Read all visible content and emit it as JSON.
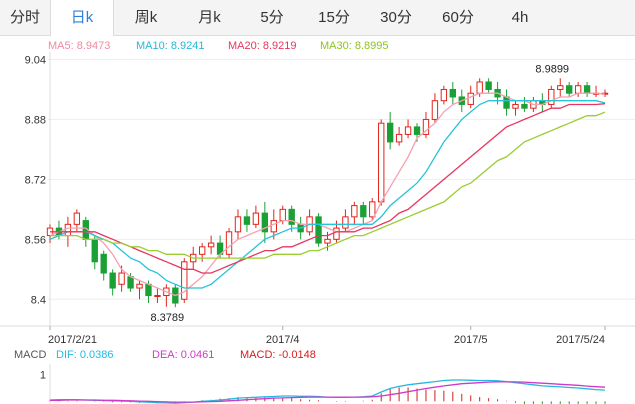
{
  "tabs": [
    "分时",
    "日k",
    "周k",
    "月k",
    "5分",
    "15分",
    "30分",
    "60分",
    "4h"
  ],
  "active_tab": 1,
  "colors": {
    "up": "#e1251b",
    "down": "#1aa035",
    "ma5": "#f5a0b0",
    "ma10": "#27c3d6",
    "ma20": "#e8365f",
    "ma30": "#9acd32",
    "dif": "#27b8e0",
    "dea": "#cc3cc8",
    "macd": "#d81b1b"
  },
  "legend": [
    {
      "label": "MA5: 8.9473",
      "color": "#f08aa2"
    },
    {
      "label": "MA10: 8.9241",
      "color": "#27b8d6"
    },
    {
      "label": "MA20: 8.9219",
      "color": "#e8365f"
    },
    {
      "label": "MA30: 8.8995",
      "color": "#8fc31f"
    }
  ],
  "macd_legend": [
    {
      "label": "MACD",
      "color": "#555555"
    },
    {
      "label": "DIF: 0.0386",
      "color": "#27b8e0"
    },
    {
      "label": "DEA: 0.0461",
      "color": "#cc3cc8"
    },
    {
      "label": "MACD: -0.0148",
      "color": "#d81b1b"
    }
  ],
  "chart_data": {
    "type": "candlestick",
    "ylim": [
      8.35,
      9.06
    ],
    "y_ticks": [
      9.04,
      8.88,
      8.72,
      8.56,
      8.4
    ],
    "y_tick_labels": [
      "9.04",
      "8.88",
      "8.72",
      "8.56",
      "8.4"
    ],
    "x_tick_labels": [
      {
        "label": "2017/2/21",
        "index": 0
      },
      {
        "label": "2017/4",
        "index": 26
      },
      {
        "label": "2017/5",
        "index": 47
      },
      {
        "label": "2017/5/24",
        "index": 62
      }
    ],
    "annotations": [
      {
        "label": "8.9899",
        "index": 57,
        "value": 8.9899
      },
      {
        "label": "8.3789",
        "index": 14,
        "value": 8.3789
      }
    ],
    "candles": [
      [
        8.57,
        8.59,
        8.55,
        8.6
      ],
      [
        8.59,
        8.57,
        8.56,
        8.61
      ],
      [
        8.57,
        8.6,
        8.54,
        8.62
      ],
      [
        8.6,
        8.63,
        8.58,
        8.64
      ],
      [
        8.61,
        8.56,
        8.54,
        8.62
      ],
      [
        8.56,
        8.5,
        8.48,
        8.57
      ],
      [
        8.52,
        8.47,
        8.45,
        8.53
      ],
      [
        8.47,
        8.43,
        8.41,
        8.48
      ],
      [
        8.44,
        8.47,
        8.42,
        8.49
      ],
      [
        8.46,
        8.43,
        8.42,
        8.47
      ],
      [
        8.43,
        8.44,
        8.4,
        8.45
      ],
      [
        8.44,
        8.41,
        8.39,
        8.45
      ],
      [
        8.41,
        8.41,
        8.39,
        8.43
      ],
      [
        8.41,
        8.43,
        8.38,
        8.44
      ],
      [
        8.43,
        8.39,
        8.3789,
        8.44
      ],
      [
        8.4,
        8.5,
        8.39,
        8.51
      ],
      [
        8.5,
        8.52,
        8.48,
        8.54
      ],
      [
        8.52,
        8.54,
        8.5,
        8.55
      ],
      [
        8.54,
        8.55,
        8.52,
        8.57
      ],
      [
        8.55,
        8.52,
        8.51,
        8.57
      ],
      [
        8.52,
        8.58,
        8.51,
        8.59
      ],
      [
        8.58,
        8.62,
        8.56,
        8.64
      ],
      [
        8.62,
        8.6,
        8.58,
        8.64
      ],
      [
        8.6,
        8.63,
        8.59,
        8.65
      ],
      [
        8.63,
        8.58,
        8.55,
        8.66
      ],
      [
        8.58,
        8.61,
        8.56,
        8.64
      ],
      [
        8.61,
        8.64,
        8.6,
        8.65
      ],
      [
        8.64,
        8.6,
        8.58,
        8.65
      ],
      [
        8.6,
        8.58,
        8.56,
        8.62
      ],
      [
        8.58,
        8.62,
        8.57,
        8.64
      ],
      [
        8.62,
        8.55,
        8.54,
        8.63
      ],
      [
        8.55,
        8.56,
        8.53,
        8.58
      ],
      [
        8.56,
        8.59,
        8.55,
        8.61
      ],
      [
        8.59,
        8.62,
        8.58,
        8.64
      ],
      [
        8.62,
        8.65,
        8.6,
        8.66
      ],
      [
        8.65,
        8.62,
        8.6,
        8.66
      ],
      [
        8.62,
        8.66,
        8.61,
        8.67
      ],
      [
        8.66,
        8.87,
        8.65,
        8.88
      ],
      [
        8.87,
        8.82,
        8.8,
        8.9
      ],
      [
        8.82,
        8.84,
        8.81,
        8.86
      ],
      [
        8.84,
        8.86,
        8.83,
        8.88
      ],
      [
        8.86,
        8.84,
        8.82,
        8.87
      ],
      [
        8.84,
        8.88,
        8.83,
        8.9
      ],
      [
        8.88,
        8.93,
        8.87,
        8.95
      ],
      [
        8.93,
        8.96,
        8.92,
        8.97
      ],
      [
        8.96,
        8.94,
        8.92,
        8.98
      ],
      [
        8.94,
        8.92,
        8.9,
        8.96
      ],
      [
        8.92,
        8.95,
        8.91,
        8.97
      ],
      [
        8.95,
        8.98,
        8.94,
        8.99
      ],
      [
        8.98,
        8.96,
        8.95,
        8.99
      ],
      [
        8.96,
        8.94,
        8.92,
        8.98
      ],
      [
        8.94,
        8.91,
        8.89,
        8.96
      ],
      [
        8.91,
        8.92,
        8.89,
        8.93
      ],
      [
        8.92,
        8.91,
        8.9,
        8.94
      ],
      [
        8.91,
        8.93,
        8.9,
        8.94
      ],
      [
        8.93,
        8.92,
        8.9,
        8.95
      ],
      [
        8.92,
        8.96,
        8.91,
        8.97
      ],
      [
        8.96,
        8.97,
        8.94,
        8.9899
      ],
      [
        8.97,
        8.95,
        8.94,
        8.98
      ],
      [
        8.95,
        8.97,
        8.94,
        8.98
      ],
      [
        8.97,
        8.95,
        8.94,
        8.98
      ],
      [
        8.95,
        8.95,
        8.94,
        8.97
      ],
      [
        8.95,
        8.95,
        8.94,
        8.96
      ]
    ],
    "series": [
      {
        "name": "MA5",
        "values": [
          8.57,
          8.58,
          8.59,
          8.59,
          8.59,
          8.57,
          8.55,
          8.52,
          8.48,
          8.46,
          8.45,
          8.44,
          8.43,
          8.42,
          8.41,
          8.42,
          8.44,
          8.46,
          8.49,
          8.52,
          8.54,
          8.56,
          8.57,
          8.58,
          8.59,
          8.6,
          8.61,
          8.61,
          8.6,
          8.6,
          8.6,
          8.59,
          8.58,
          8.58,
          8.59,
          8.6,
          8.61,
          8.66,
          8.7,
          8.74,
          8.78,
          8.83,
          8.85,
          8.87,
          8.9,
          8.92,
          8.93,
          8.94,
          8.95,
          8.95,
          8.95,
          8.94,
          8.93,
          8.93,
          8.92,
          8.92,
          8.93,
          8.94,
          8.94,
          8.95,
          8.95,
          8.95,
          8.9473
        ]
      },
      {
        "name": "MA10",
        "values": [
          8.56,
          8.57,
          8.58,
          8.58,
          8.58,
          8.57,
          8.56,
          8.55,
          8.53,
          8.51,
          8.5,
          8.48,
          8.47,
          8.45,
          8.44,
          8.43,
          8.43,
          8.43,
          8.44,
          8.46,
          8.48,
          8.5,
          8.52,
          8.54,
          8.56,
          8.57,
          8.58,
          8.59,
          8.59,
          8.6,
          8.6,
          8.6,
          8.6,
          8.6,
          8.6,
          8.6,
          8.6,
          8.62,
          8.65,
          8.67,
          8.69,
          8.71,
          8.74,
          8.78,
          8.82,
          8.85,
          8.88,
          8.9,
          8.92,
          8.93,
          8.93,
          8.93,
          8.93,
          8.93,
          8.93,
          8.93,
          8.93,
          8.93,
          8.93,
          8.93,
          8.93,
          8.93,
          8.9241
        ]
      },
      {
        "name": "MA20",
        "values": [
          8.58,
          8.58,
          8.58,
          8.58,
          8.58,
          8.58,
          8.57,
          8.56,
          8.55,
          8.54,
          8.53,
          8.52,
          8.51,
          8.5,
          8.49,
          8.48,
          8.48,
          8.47,
          8.47,
          8.48,
          8.49,
          8.5,
          8.51,
          8.52,
          8.53,
          8.53,
          8.54,
          8.54,
          8.55,
          8.56,
          8.57,
          8.57,
          8.58,
          8.58,
          8.58,
          8.59,
          8.59,
          8.6,
          8.61,
          8.63,
          8.64,
          8.66,
          8.68,
          8.7,
          8.72,
          8.74,
          8.76,
          8.78,
          8.8,
          8.82,
          8.84,
          8.86,
          8.87,
          8.88,
          8.89,
          8.9,
          8.91,
          8.91,
          8.92,
          8.92,
          8.92,
          8.92,
          8.9219
        ]
      },
      {
        "name": "MA30",
        "values": [
          8.57,
          8.57,
          8.57,
          8.57,
          8.56,
          8.56,
          8.56,
          8.55,
          8.55,
          8.54,
          8.54,
          8.53,
          8.53,
          8.52,
          8.52,
          8.52,
          8.51,
          8.51,
          8.51,
          8.51,
          8.51,
          8.51,
          8.51,
          8.51,
          8.51,
          8.52,
          8.52,
          8.52,
          8.52,
          8.53,
          8.53,
          8.54,
          8.55,
          8.56,
          8.57,
          8.57,
          8.58,
          8.59,
          8.6,
          8.61,
          8.62,
          8.63,
          8.64,
          8.65,
          8.66,
          8.68,
          8.7,
          8.71,
          8.73,
          8.75,
          8.77,
          8.78,
          8.8,
          8.82,
          8.83,
          8.84,
          8.85,
          8.86,
          8.87,
          8.88,
          8.89,
          8.89,
          8.8995
        ]
      }
    ],
    "macd": {
      "ylim": [
        -0.1,
        1.4
      ],
      "y_tick_labels": [
        "1"
      ],
      "dif": [
        0.05,
        0.06,
        0.06,
        0.06,
        0.05,
        0.04,
        0.03,
        0.02,
        0.01,
        0.0,
        -0.02,
        -0.03,
        -0.05,
        -0.06,
        -0.07,
        -0.05,
        -0.03,
        0.0,
        0.02,
        0.05,
        0.08,
        0.12,
        0.14,
        0.15,
        0.17,
        0.18,
        0.2,
        0.2,
        0.19,
        0.19,
        0.18,
        0.16,
        0.15,
        0.15,
        0.16,
        0.17,
        0.2,
        0.35,
        0.48,
        0.56,
        0.62,
        0.66,
        0.7,
        0.74,
        0.78,
        0.8,
        0.8,
        0.79,
        0.78,
        0.78,
        0.77,
        0.74,
        0.7,
        0.66,
        0.62,
        0.58,
        0.56,
        0.54,
        0.52,
        0.5,
        0.47,
        0.44,
        0.42
      ],
      "dea": [
        0.04,
        0.04,
        0.05,
        0.05,
        0.05,
        0.05,
        0.04,
        0.04,
        0.03,
        0.02,
        0.01,
        0.0,
        -0.01,
        -0.02,
        -0.03,
        -0.03,
        -0.03,
        -0.02,
        -0.01,
        0.0,
        0.02,
        0.04,
        0.06,
        0.08,
        0.1,
        0.12,
        0.13,
        0.14,
        0.15,
        0.16,
        0.16,
        0.16,
        0.16,
        0.16,
        0.16,
        0.16,
        0.17,
        0.2,
        0.25,
        0.3,
        0.36,
        0.42,
        0.48,
        0.53,
        0.58,
        0.62,
        0.66,
        0.68,
        0.7,
        0.72,
        0.73,
        0.73,
        0.73,
        0.72,
        0.7,
        0.68,
        0.66,
        0.64,
        0.62,
        0.6,
        0.57,
        0.55,
        0.53
      ],
      "hist": [
        0.02,
        0.04,
        0.02,
        0.02,
        0.0,
        -0.02,
        -0.02,
        -0.04,
        -0.04,
        -0.04,
        -0.06,
        -0.06,
        -0.08,
        -0.08,
        -0.08,
        -0.04,
        0.0,
        0.04,
        0.06,
        0.1,
        0.12,
        0.16,
        0.16,
        0.14,
        0.14,
        0.12,
        0.14,
        0.12,
        0.08,
        0.06,
        0.04,
        0.0,
        -0.02,
        -0.02,
        0.0,
        0.02,
        0.06,
        0.3,
        0.46,
        0.52,
        0.52,
        0.48,
        0.44,
        0.42,
        0.4,
        0.36,
        0.28,
        0.22,
        0.16,
        0.12,
        0.08,
        0.02,
        -0.06,
        -0.12,
        -0.16,
        -0.2,
        -0.2,
        -0.2,
        -0.2,
        -0.2,
        -0.2,
        -0.22,
        -0.22
      ]
    }
  }
}
